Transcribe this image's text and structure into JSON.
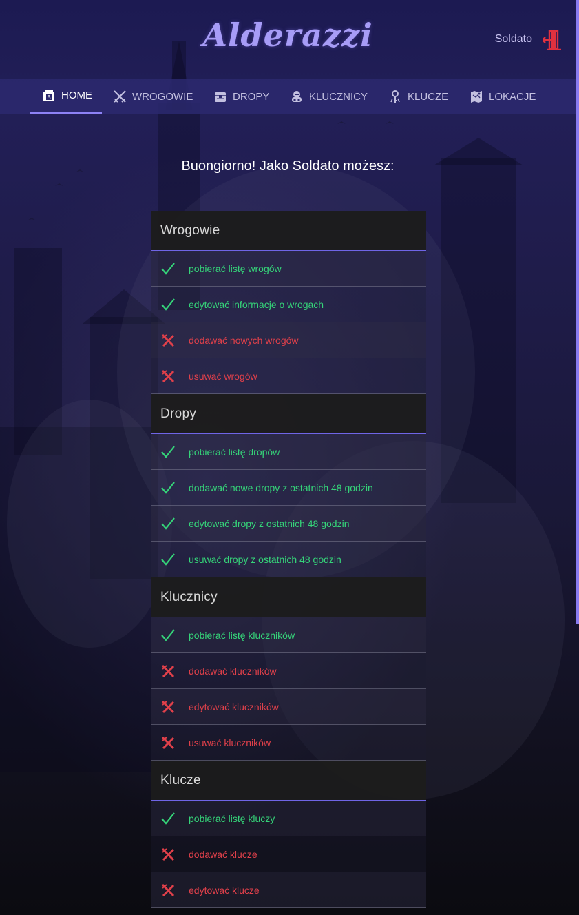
{
  "app": {
    "brand": "Alderazzi",
    "user_name": "Soldato",
    "logout_icon": "door-exit-icon",
    "accent": "#8d82f5",
    "allowed_color": "#35d479",
    "denied_color": "#e0404a"
  },
  "nav": {
    "items": [
      {
        "label": "HOME",
        "icon": "home-icon",
        "active": true
      },
      {
        "label": "WROGOWIE",
        "icon": "crossed-swords-icon",
        "active": false
      },
      {
        "label": "DROPY",
        "icon": "chest-icon",
        "active": false
      },
      {
        "label": "KLUCZNICY",
        "icon": "keymaster-icon",
        "active": false
      },
      {
        "label": "KLUCZE",
        "icon": "key-icon",
        "active": false
      },
      {
        "label": "LOKACJE",
        "icon": "map-icon",
        "active": false
      }
    ]
  },
  "greeting": "Buongiorno! Jako Soldato możesz:",
  "sections": [
    {
      "title": "Wrogowie",
      "permissions": [
        {
          "label": "pobierać listę wrogów",
          "allowed": true
        },
        {
          "label": "edytować informacje o wrogach",
          "allowed": true
        },
        {
          "label": "dodawać nowych wrogów",
          "allowed": false
        },
        {
          "label": "usuwać wrogów",
          "allowed": false
        }
      ]
    },
    {
      "title": "Dropy",
      "permissions": [
        {
          "label": "pobierać listę dropów",
          "allowed": true
        },
        {
          "label": "dodawać nowe dropy z ostatnich 48 godzin",
          "allowed": true
        },
        {
          "label": "edytować dropy z ostatnich 48 godzin",
          "allowed": true
        },
        {
          "label": "usuwać dropy z ostatnich 48 godzin",
          "allowed": true
        }
      ]
    },
    {
      "title": "Klucznicy",
      "permissions": [
        {
          "label": "pobierać listę kluczników",
          "allowed": true
        },
        {
          "label": "dodawać kluczników",
          "allowed": false
        },
        {
          "label": "edytować kluczników",
          "allowed": false
        },
        {
          "label": "usuwać kluczników",
          "allowed": false
        }
      ]
    },
    {
      "title": "Klucze",
      "permissions": [
        {
          "label": "pobierać listę kluczy",
          "allowed": true
        },
        {
          "label": "dodawać klucze",
          "allowed": false
        },
        {
          "label": "edytować klucze",
          "allowed": false
        }
      ]
    }
  ]
}
